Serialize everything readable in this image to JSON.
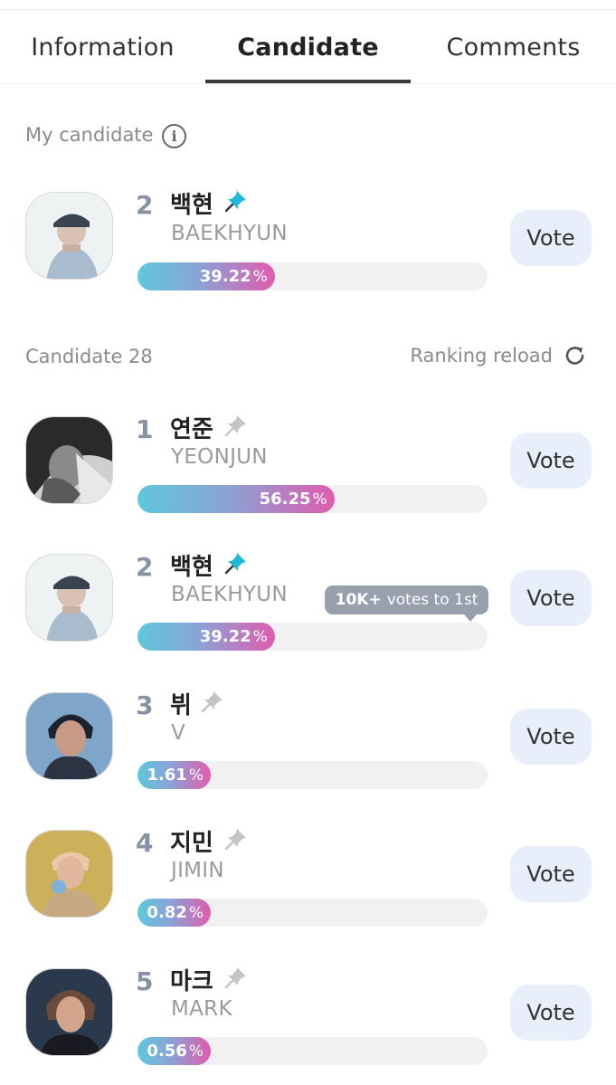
{
  "tabs": [
    {
      "label": "Information",
      "active": false
    },
    {
      "label": "Candidate",
      "active": true
    },
    {
      "label": "Comments",
      "active": false
    }
  ],
  "my_candidate": {
    "section_label": "My candidate",
    "info_icon": "info-icon",
    "rank": "2",
    "name_ko": "백현",
    "name_en": "BAEKHYUN",
    "pinned": true,
    "percent": 39.22,
    "percent_label": "39.22",
    "vote_label": "Vote"
  },
  "candidates_header": {
    "label": "Candidate 28",
    "reload_label": "Ranking reload",
    "reload_icon": "refresh-icon"
  },
  "percent_symbol": "%",
  "candidates": [
    {
      "rank": "1",
      "name_ko": "연준",
      "name_en": "YEONJUN",
      "pinned": false,
      "percent": 56.25,
      "percent_label": "56.25",
      "vote_label": "Vote",
      "avatar_style": "bw"
    },
    {
      "rank": "2",
      "name_ko": "백현",
      "name_en": "BAEKHYUN",
      "pinned": true,
      "percent": 39.22,
      "percent_label": "39.22",
      "vote_label": "Vote",
      "avatar_style": "light"
    },
    {
      "rank": "3",
      "name_ko": "뷔",
      "name_en": "V",
      "pinned": false,
      "percent": 1.61,
      "percent_label": "1.61",
      "vote_label": "Vote",
      "avatar_style": "dark-blue"
    },
    {
      "rank": "4",
      "name_ko": "지민",
      "name_en": "JIMIN",
      "pinned": false,
      "percent": 0.82,
      "percent_label": "0.82",
      "vote_label": "Vote",
      "avatar_style": "gold"
    },
    {
      "rank": "5",
      "name_ko": "마크",
      "name_en": "MARK",
      "pinned": false,
      "percent": 0.56,
      "percent_label": "0.56",
      "vote_label": "Vote",
      "avatar_style": "dark"
    }
  ],
  "tooltip": {
    "strong": "10K+",
    "text": "votes to 1st"
  },
  "colors": {
    "pin_active": "#1fb8d6",
    "pin_inactive": "#c4c4c4",
    "bar_start": "#5ec8dc",
    "bar_end": "#e05cae",
    "vote_bg": "#e9eefb"
  }
}
